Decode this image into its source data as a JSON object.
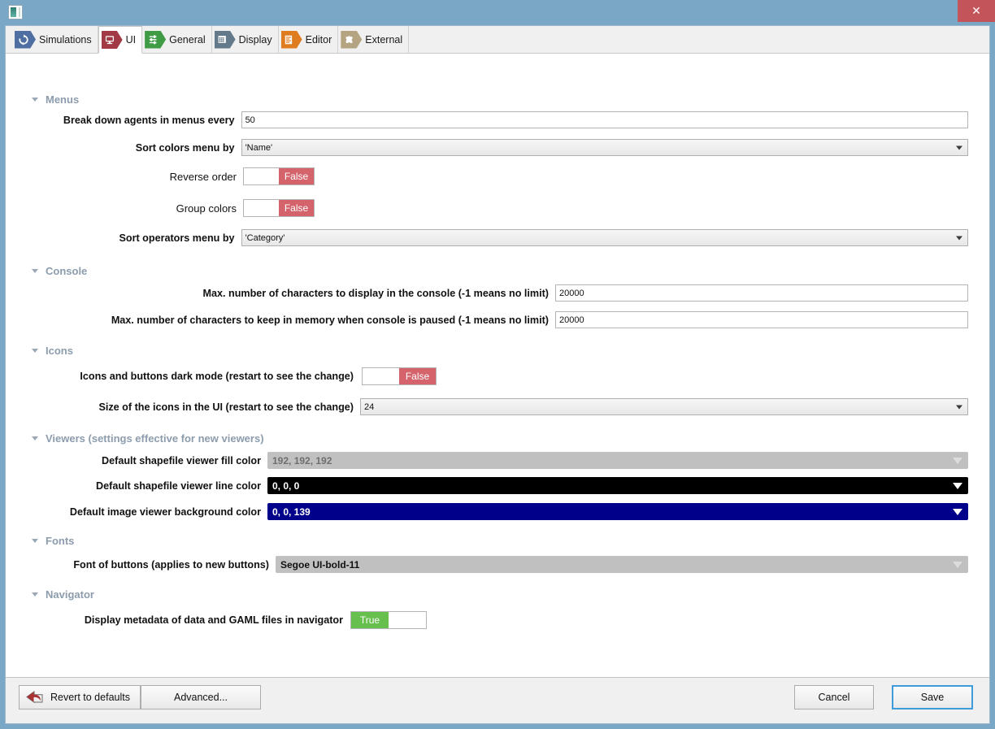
{
  "window": {
    "icon_name": "window-icon",
    "close_label": "✕"
  },
  "tabs": [
    {
      "label": "Simulations",
      "icon": "refresh-icon",
      "color": "#4f6fa3",
      "active": false
    },
    {
      "label": "UI",
      "icon": "monitor-icon",
      "color": "#a23a45",
      "active": true
    },
    {
      "label": "General",
      "icon": "sliders-icon",
      "color": "#3f9c45",
      "active": false
    },
    {
      "label": "Display",
      "icon": "grid-icon",
      "color": "#64798a",
      "active": false
    },
    {
      "label": "Editor",
      "icon": "document-lines-icon",
      "color": "#e07c20",
      "active": false
    },
    {
      "label": "External",
      "icon": "puzzle-icon",
      "color": "#b5a481",
      "active": false
    }
  ],
  "sections": {
    "menus": {
      "title": "Menus",
      "break_down_label": "Break down agents in menus every",
      "break_down_value": "50",
      "sort_colors_label": "Sort colors menu by",
      "sort_colors_value": "'Name'",
      "reverse_order_label": "Reverse order",
      "reverse_order_value": "False",
      "group_colors_label": "Group colors",
      "group_colors_value": "False",
      "sort_operators_label": "Sort operators menu by",
      "sort_operators_value": "'Category'"
    },
    "console": {
      "title": "Console",
      "max_display_label": "Max. number of characters to display in the console (-1 means no limit)",
      "max_display_value": "20000",
      "max_memory_label": "Max. number of characters to keep in memory when console is paused (-1 means no limit)",
      "max_memory_value": "20000"
    },
    "icons": {
      "title": "Icons",
      "dark_mode_label": "Icons and buttons dark mode (restart to see the change)",
      "dark_mode_value": "False",
      "icon_size_label": "Size of the icons in the UI (restart to see the change)",
      "icon_size_value": "24"
    },
    "viewers": {
      "title": "Viewers (settings effective for new viewers)",
      "fill_color_label": "Default shapefile viewer fill color",
      "fill_color_value": "192, 192, 192",
      "fill_color_hex": "#c0c0c0",
      "fill_color_text": "#6e6e6e",
      "line_color_label": "Default shapefile viewer line color",
      "line_color_value": "0, 0, 0",
      "line_color_hex": "#000000",
      "line_color_text": "#ffffff",
      "bg_color_label": "Default image viewer background color",
      "bg_color_value": "0, 0, 139",
      "bg_color_hex": "#00008b",
      "bg_color_text": "#ffffff"
    },
    "fonts": {
      "title": "Fonts",
      "button_font_label": "Font of buttons (applies to new buttons)",
      "button_font_value": "Segoe UI-bold-11"
    },
    "navigator": {
      "title": "Navigator",
      "metadata_label": "Display metadata of data and GAML files in navigator",
      "metadata_value": "True"
    }
  },
  "footer": {
    "revert_label": "Revert to defaults",
    "revert_icon": "undo-arrow-icon",
    "advanced_label": "Advanced...",
    "cancel_label": "Cancel",
    "save_label": "Save"
  }
}
